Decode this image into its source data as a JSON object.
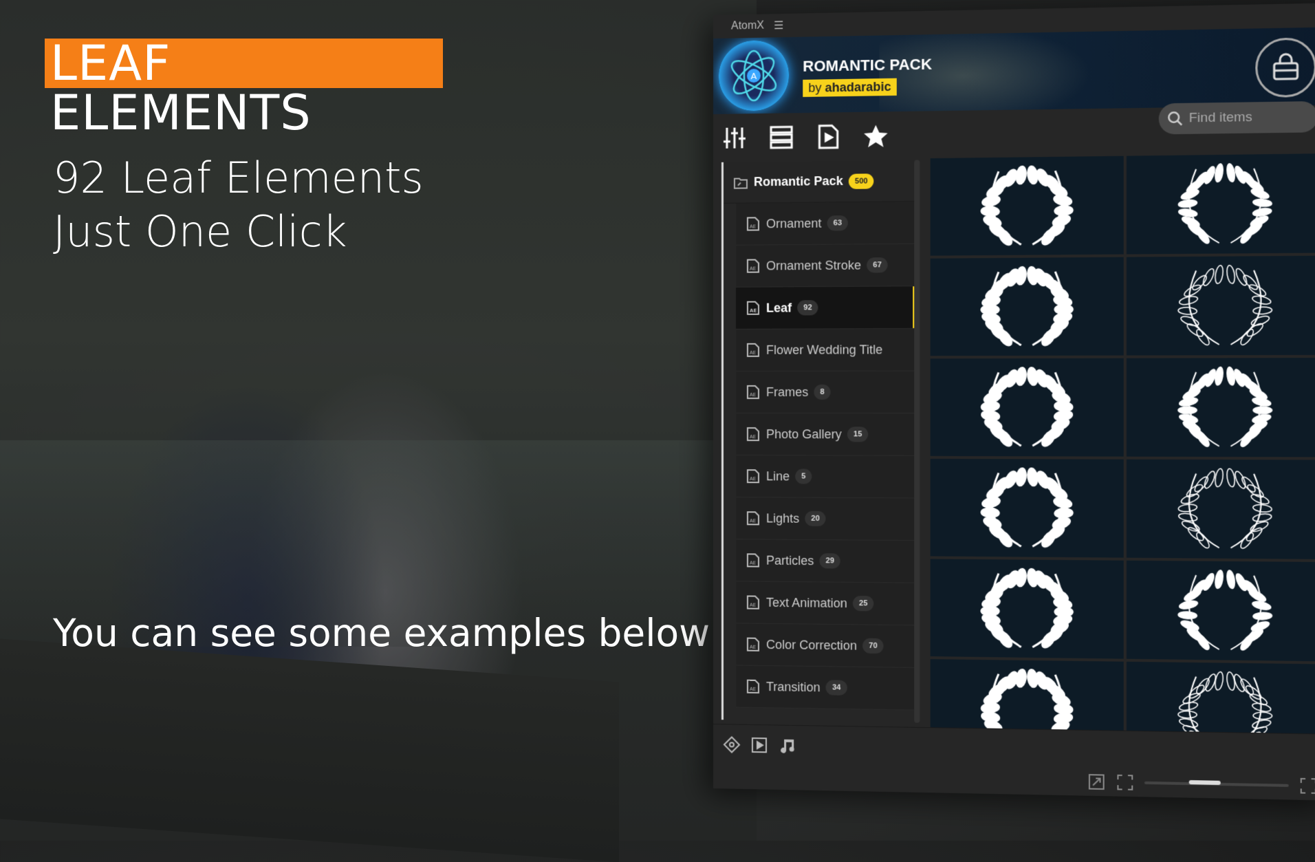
{
  "promo": {
    "badge_title": "LEAF ELEMENTS",
    "headline_line1": "92 Leaf Elements",
    "headline_line2": "Just One Click",
    "subline": "You can see some examples below",
    "accent_color": "#f57f17"
  },
  "app": {
    "name": "AtomX",
    "menu_icon": "hamburger-icon",
    "banner": {
      "title": "ROMANTIC PACK",
      "by": "by",
      "author": "ahadarabic",
      "accent_color": "#f7d21b"
    },
    "toolbar": {
      "icons": [
        "sliders-icon",
        "list-icon",
        "video-file-icon",
        "star-icon"
      ]
    },
    "search": {
      "placeholder": "Find items",
      "value": ""
    },
    "sidebar": {
      "root": {
        "label": "Romantic Pack",
        "count": "500"
      },
      "items": [
        {
          "label": "Ornament",
          "count": "63"
        },
        {
          "label": "Ornament Stroke",
          "count": "67"
        },
        {
          "label": "Leaf",
          "count": "92",
          "active": true
        },
        {
          "label": "Flower Wedding Title",
          "count": ""
        },
        {
          "label": "Frames",
          "count": "8"
        },
        {
          "label": "Photo Gallery",
          "count": "15"
        },
        {
          "label": "Line",
          "count": "5"
        },
        {
          "label": "Lights",
          "count": "20"
        },
        {
          "label": "Particles",
          "count": "29"
        },
        {
          "label": "Text Animation",
          "count": "25"
        },
        {
          "label": "Color Correction",
          "count": "70"
        },
        {
          "label": "Transition",
          "count": "34"
        }
      ]
    },
    "grid": {
      "thumbnail_count": 12,
      "thumbnail_kind": "laurel-wreath"
    },
    "bottom": {
      "icons": [
        "gamepad-icon",
        "play-icon",
        "music-icon"
      ],
      "zoom_level": 0.4
    }
  }
}
